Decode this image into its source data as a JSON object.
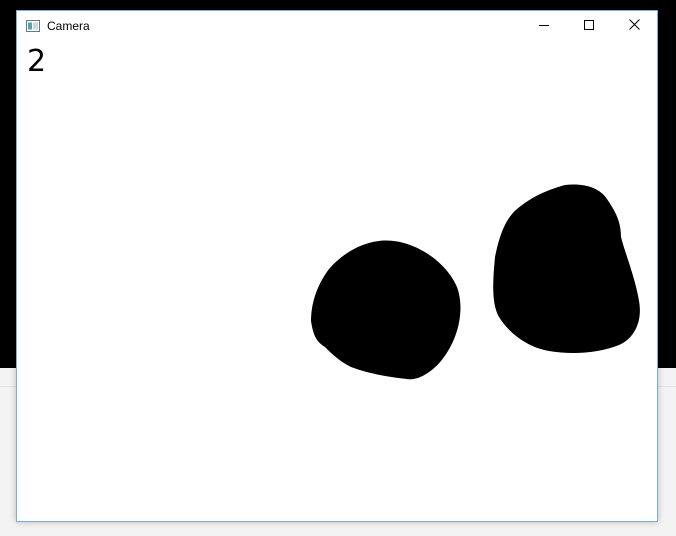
{
  "window": {
    "title": "Camera",
    "icon": "app-window-icon",
    "controls": {
      "minimize_icon": "minimize-icon",
      "maximize_icon": "maximize-icon",
      "close_icon": "close-icon"
    }
  },
  "canvas": {
    "count_text": "2",
    "background_color": "#ffffff",
    "blob_color": "#000000"
  },
  "colors": {
    "window_border": "#7eaedb",
    "desktop_background": "#000000"
  }
}
